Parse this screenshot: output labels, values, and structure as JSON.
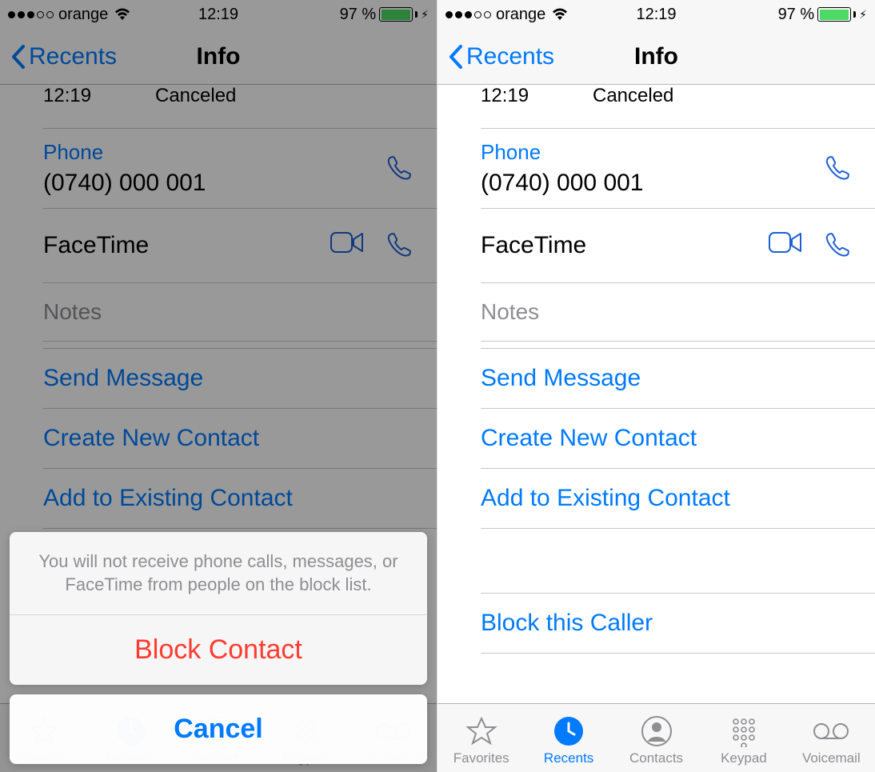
{
  "status": {
    "carrier": "orange",
    "time": "12:19",
    "battery_pct": "97 %",
    "battery_fill": 97
  },
  "nav": {
    "back_label": "Recents",
    "title": "Info"
  },
  "call_peek": {
    "time": "12:19",
    "status": "Canceled"
  },
  "phone": {
    "label": "Phone",
    "number": "(0740) 000 001"
  },
  "facetime": {
    "label": "FaceTime"
  },
  "notes": {
    "label": "Notes"
  },
  "actions": {
    "send_message": "Send Message",
    "create_contact": "Create New Contact",
    "add_existing": "Add to Existing Contact",
    "block_caller": "Block this Caller"
  },
  "tabs": {
    "favorites": "Favorites",
    "recents": "Recents",
    "contacts": "Contacts",
    "keypad": "Keypad",
    "voicemail": "Voicemail"
  },
  "sheet": {
    "message": "You will not receive phone calls, messages, or FaceTime from people on the block list.",
    "block": "Block Contact",
    "cancel": "Cancel"
  }
}
